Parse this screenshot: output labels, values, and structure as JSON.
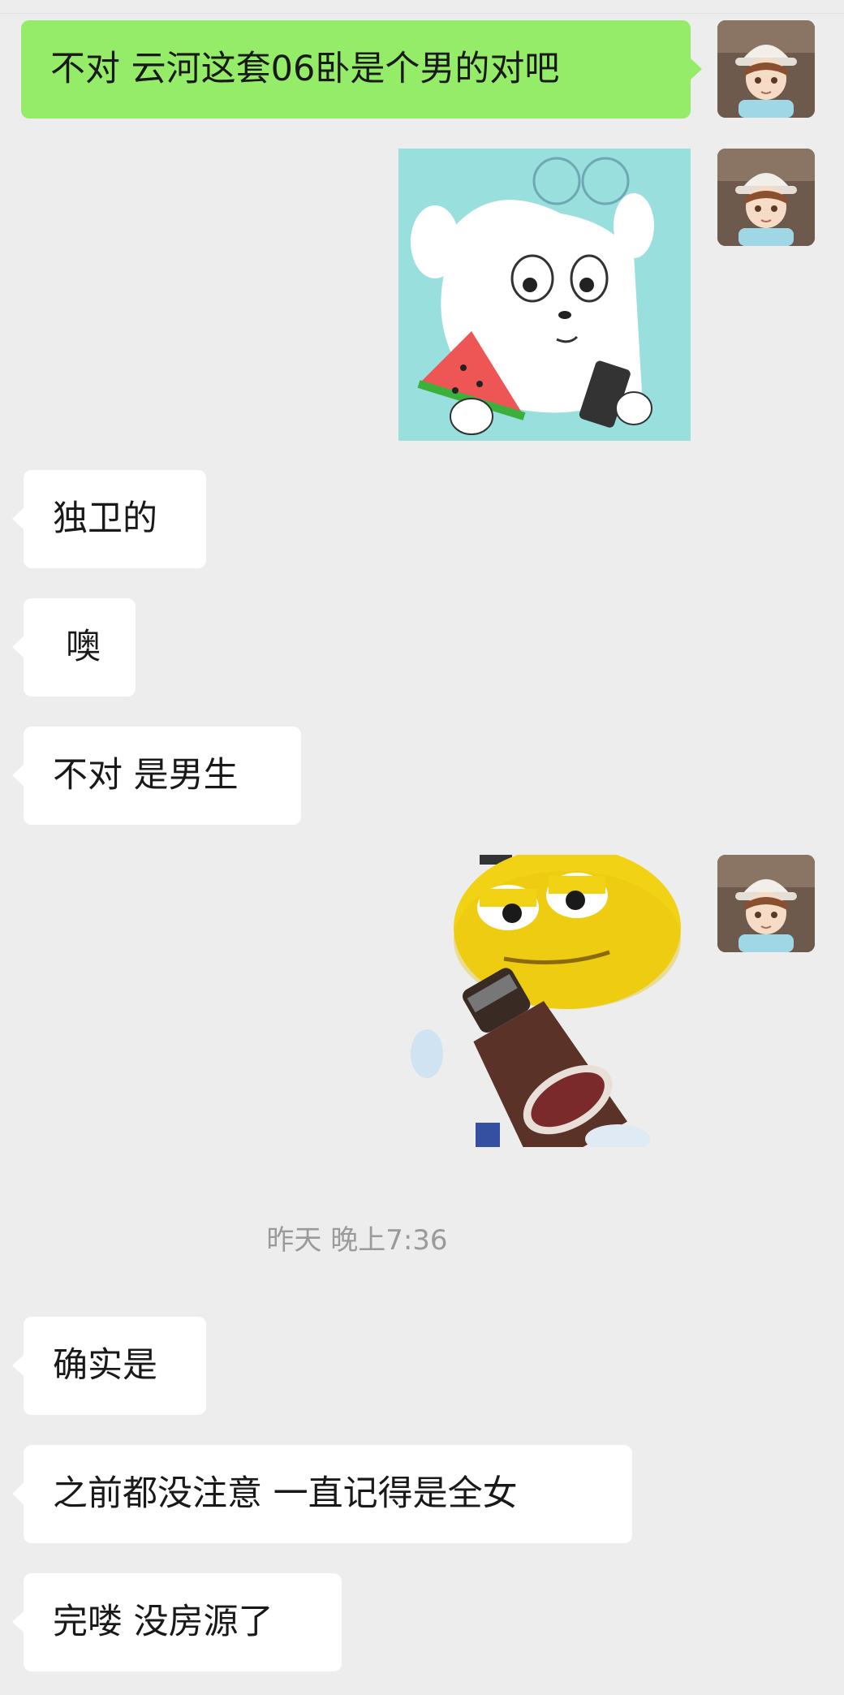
{
  "messages": [
    {
      "id": "m1",
      "sender": "self",
      "type": "text",
      "text": "不对 云河这套06卧是个男的对吧"
    },
    {
      "id": "m2",
      "sender": "self",
      "type": "sticker",
      "sticker": "white-dog-eating-watermelon-with-phone"
    },
    {
      "id": "m3",
      "sender": "other",
      "type": "text",
      "text": "独卫的"
    },
    {
      "id": "m4",
      "sender": "other",
      "type": "text",
      "text": "噢"
    },
    {
      "id": "m5",
      "sender": "other",
      "type": "text",
      "text": "不对 是男生"
    },
    {
      "id": "m6",
      "sender": "self",
      "type": "sticker",
      "sticker": "yellow-emoji-face-with-beer-bottle"
    },
    {
      "id": "m7",
      "sender": "other",
      "type": "text",
      "text": "确实是"
    },
    {
      "id": "m8",
      "sender": "other",
      "type": "text",
      "text": "之前都没注意 一直记得是全女"
    },
    {
      "id": "m9",
      "sender": "other",
      "type": "text",
      "text": "完喽 没房源了"
    }
  ],
  "timestamp": "昨天 晚上7:36",
  "avatar_icon": "anime-boy-white-cap-avatar",
  "colors": {
    "background": "#ededed",
    "self_bubble": "#95ec69",
    "other_bubble": "#ffffff",
    "text": "#191919",
    "timestamp": "#9a9a9a"
  }
}
